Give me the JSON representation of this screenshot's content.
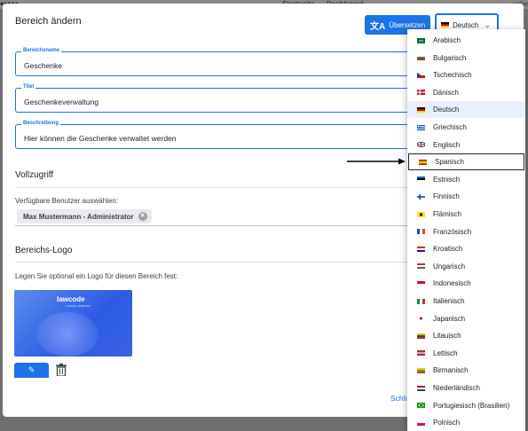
{
  "background": {
    "nav_left": "Startseite",
    "nav_right": "Dashboard",
    "search": "uche"
  },
  "dialog": {
    "title": "Bereich ändern",
    "translate_label": "Übersetzen",
    "language_value": "Deutsch",
    "fields": [
      {
        "label": "Bereichsname",
        "value": "Geschenke"
      },
      {
        "label": "Titel",
        "value": "Geschenkeverwaltung"
      },
      {
        "label": "Beschreibung",
        "value": "Hier können die Geschenke verwaltet werden"
      }
    ],
    "full_access_title": "Vollzugriff",
    "users_label": "Verfügbare Benutzer auswählen:",
    "user_chip": "Max Mustermann - Administrator",
    "logo_title": "Bereichs-Logo",
    "logo_text": "Legen Sie optional ein Logo für diesen Bereich fest:",
    "logo_brand": "lawcode",
    "logo_brand_sub": "A LEGAL COMPANY",
    "close_label": "Schlie"
  },
  "languages": [
    "Arabisch",
    "Bulgarisch",
    "Tschechisch",
    "Dänisch",
    "Deutsch",
    "Griechisch",
    "Englisch",
    "Spanisch",
    "Estnisch",
    "Finnisch",
    "Flämisch",
    "Französisch",
    "Kroatisch",
    "Ungarisch",
    "Indonesisch",
    "Italienisch",
    "Japanisch",
    "Litauisch",
    "Lettisch",
    "Birmanisch",
    "Niederländisch",
    "Portugiesisch (Brasilien)",
    "Polnisch"
  ],
  "selected_language_index": 4,
  "highlighted_language_index": 7,
  "colors": {
    "accent": "#1a73e8"
  }
}
